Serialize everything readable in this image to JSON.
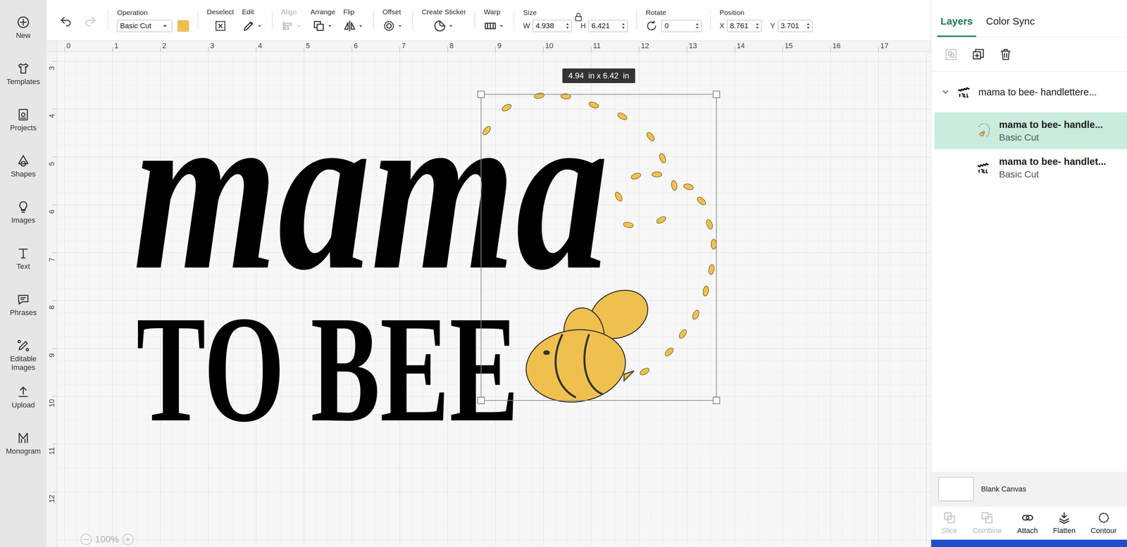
{
  "sidebar": {
    "items": [
      {
        "label": "New"
      },
      {
        "label": "Templates"
      },
      {
        "label": "Projects"
      },
      {
        "label": "Shapes"
      },
      {
        "label": "Images"
      },
      {
        "label": "Text"
      },
      {
        "label": "Phrases"
      },
      {
        "label": "Editable Images"
      },
      {
        "label": "Upload"
      },
      {
        "label": "Monogram"
      }
    ]
  },
  "toolbar": {
    "undo": {
      "disabled": false
    },
    "redo": {
      "disabled": true
    },
    "operation": {
      "label": "Operation",
      "value": "Basic Cut",
      "color": "#f0c04f"
    },
    "tools": [
      {
        "label": "Deselect",
        "kind": "button",
        "disabled": false
      },
      {
        "label": "Edit",
        "kind": "menu",
        "disabled": false
      },
      {
        "label": "Align",
        "kind": "menu",
        "disabled": true
      },
      {
        "label": "Arrange",
        "kind": "menu",
        "disabled": false
      },
      {
        "label": "Flip",
        "kind": "menu",
        "disabled": false
      },
      {
        "label": "Offset",
        "kind": "menu",
        "disabled": false
      },
      {
        "label": "Create Sticker",
        "kind": "menu",
        "disabled": false
      },
      {
        "label": "Warp",
        "kind": "menu",
        "disabled": false
      }
    ],
    "size": {
      "label": "Size",
      "locked": true,
      "fields": [
        {
          "label": "W",
          "value": "4.938"
        },
        {
          "label": "H",
          "value": "6.421"
        }
      ]
    },
    "rotate": {
      "label": "Rotate",
      "value": "0"
    },
    "position": {
      "label": "Position",
      "fields": [
        {
          "label": "X",
          "value": "8.761"
        },
        {
          "label": "Y",
          "value": "3.701"
        }
      ]
    }
  },
  "canvas": {
    "ruler_top": [
      "0",
      "1",
      "2",
      "3",
      "4",
      "5",
      "6",
      "7",
      "8",
      "9",
      "10",
      "11",
      "12",
      "13",
      "14",
      "15",
      "16",
      "17"
    ],
    "ruler_left": [
      "3",
      "4",
      "5",
      "6",
      "7",
      "8",
      "9",
      "10",
      "11",
      "12"
    ],
    "design": {
      "line1": "mama",
      "line2": "TO BEE"
    },
    "selection": {
      "tooltip": "4.94  in x 6.42  in"
    },
    "zoom": {
      "minus": "−",
      "value": "100%",
      "plus": "+"
    }
  },
  "layers_panel": {
    "tabs": [
      {
        "label": "Layers",
        "selected": true
      },
      {
        "label": "Color Sync",
        "selected": false
      }
    ],
    "actions": [
      {
        "kind": "group",
        "disabled": true
      },
      {
        "kind": "duplicate",
        "disabled": false
      },
      {
        "kind": "delete",
        "disabled": false
      }
    ],
    "group": {
      "title": "mama to bee- handlettere...",
      "expanded": true
    },
    "layers": [
      {
        "title": "mama to bee- handle...",
        "operation": "Basic Cut",
        "selected": true,
        "kind": "bee"
      },
      {
        "title": "mama to bee- handlet...",
        "operation": "Basic Cut",
        "selected": false,
        "kind": "text"
      }
    ],
    "canvas_setting": {
      "label": "Blank Canvas"
    },
    "bottom_actions": [
      {
        "label": "Slice",
        "disabled": true
      },
      {
        "label": "Combine",
        "disabled": true
      },
      {
        "label": "Attach",
        "disabled": false
      },
      {
        "label": "Flatten",
        "disabled": false
      },
      {
        "label": "Contour",
        "disabled": false
      }
    ]
  }
}
